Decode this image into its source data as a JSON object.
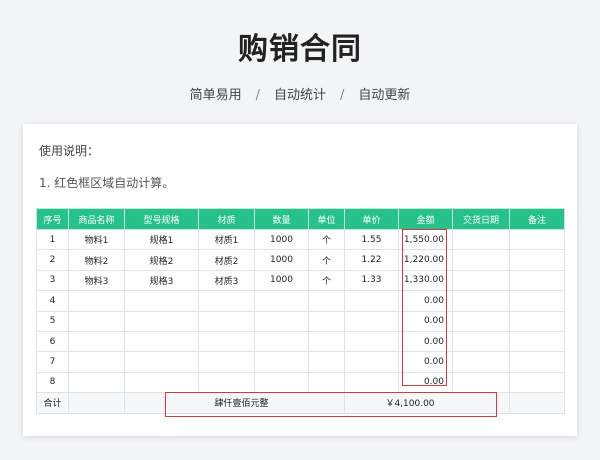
{
  "title": "购销合同",
  "features": [
    "简单易用",
    "自动统计",
    "自动更新"
  ],
  "feature_sep": "/",
  "notes": {
    "title": "使用说明：",
    "items": [
      "1. 红色框区域自动计算。"
    ]
  },
  "table": {
    "headers": [
      "序号",
      "商品名称",
      "型号规格",
      "材质",
      "数量",
      "单位",
      "单价",
      "金额",
      "交货日期",
      "备注"
    ],
    "rows": [
      [
        "1",
        "物料1",
        "规格1",
        "材质1",
        "1000",
        "个",
        "1.55",
        "1,550.00",
        "",
        ""
      ],
      [
        "2",
        "物料2",
        "规格2",
        "材质2",
        "1000",
        "个",
        "1.22",
        "1,220.00",
        "",
        ""
      ],
      [
        "3",
        "物料3",
        "规格3",
        "材质3",
        "1000",
        "个",
        "1.33",
        "1,330.00",
        "",
        ""
      ],
      [
        "4",
        "",
        "",
        "",
        "",
        "",
        "",
        "0.00",
        "",
        ""
      ],
      [
        "5",
        "",
        "",
        "",
        "",
        "",
        "",
        "0.00",
        "",
        ""
      ],
      [
        "6",
        "",
        "",
        "",
        "",
        "",
        "",
        "0.00",
        "",
        ""
      ],
      [
        "7",
        "",
        "",
        "",
        "",
        "",
        "",
        "0.00",
        "",
        ""
      ],
      [
        "8",
        "",
        "",
        "",
        "",
        "",
        "",
        "0.00",
        "",
        ""
      ]
    ],
    "total": {
      "label": "合计",
      "words": "肆仟壹佰元整",
      "amount": "￥4,100.00"
    }
  },
  "colors": {
    "header_bg": "#27c28a",
    "highlight_border": "#d9363e"
  }
}
